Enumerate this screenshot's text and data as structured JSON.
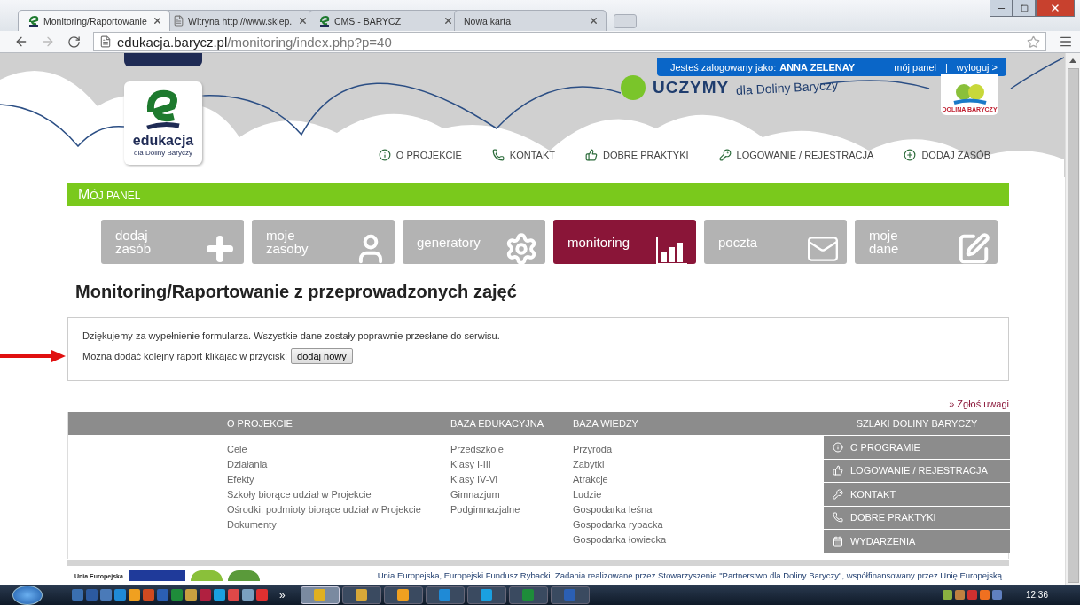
{
  "browser": {
    "tabs": [
      {
        "title": "Monitoring/Raportowanie",
        "kind": "logo",
        "selected": true
      },
      {
        "title": "Witryna http://www.sklep.",
        "kind": "document",
        "selected": false
      },
      {
        "title": "CMS - BARYCZ",
        "kind": "logo",
        "selected": false
      },
      {
        "title": "Nowa karta",
        "kind": "none",
        "selected": false
      }
    ],
    "address": {
      "domain": "edukacja.barycz.pl",
      "path": "/monitoring/index.php?p=40"
    }
  },
  "header": {
    "user_bar": {
      "prefix": "Jesteś zalogowany jako:",
      "user": "ANNA ZELENAY",
      "links": [
        "mój panel",
        "wyloguj >"
      ],
      "separator": "|"
    },
    "logo": {
      "title": "edukacja",
      "subtitle": "dla Doliny Baryczy"
    },
    "slogan": {
      "strong": "UCZYMY",
      "rest": "dla Doliny Baryczy"
    },
    "partner_logo": {
      "text": "DOLINA BARYCZY"
    },
    "nav": [
      {
        "label": "O PROJEKCIE",
        "kind": "info"
      },
      {
        "label": "KONTAKT",
        "kind": "phone"
      },
      {
        "label": "DOBRE PRAKTYKI",
        "kind": "thumb"
      },
      {
        "label": "LOGOWANIE / REJESTRACJA",
        "kind": "key"
      },
      {
        "label": "DODAJ ZASÓB",
        "kind": "plus"
      }
    ]
  },
  "panel_title": "MÓJ PANEL",
  "tiles": [
    {
      "label": "dodaj\nzasób",
      "kind": "plus",
      "selected": false
    },
    {
      "label": "moje\nzasoby",
      "kind": "user",
      "selected": false
    },
    {
      "label": "generatory",
      "kind": "gear",
      "selected": false
    },
    {
      "label": "monitoring",
      "kind": "chart",
      "selected": true
    },
    {
      "label": "poczta",
      "kind": "mail",
      "selected": false
    },
    {
      "label": "moje\ndane",
      "kind": "edit",
      "selected": false
    }
  ],
  "page_title": "Monitoring/Raportowanie z przeprowadzonych zajęć",
  "message": {
    "text": "Dziękujemy za wypełnienie formularza. Wszystkie dane zostały poprawnie przesłane do serwisu.",
    "prompt": "Można dodać kolejny raport klikając w przycisk:",
    "button": "dodaj nowy"
  },
  "report_link": "» Zgłoś uwagi",
  "footer": {
    "columns": [
      {
        "heading": "O PROJEKCIE",
        "items": [
          "Cele",
          "Działania",
          "Efekty",
          "Szkoły biorące udział w Projekcie",
          "Ośrodki, podmioty biorące udział w Projekcie",
          "Dokumenty"
        ]
      },
      {
        "heading": "BAZA EDUKACYJNA",
        "items": [
          "Przedszkole",
          "Klasy I-III",
          "Klasy IV-Vi",
          "Gimnazjum",
          "Podgimnazjalne"
        ]
      },
      {
        "heading": "BAZA WIEDZY",
        "items": [
          "Przyroda",
          "Zabytki",
          "Atrakcje",
          "Ludzie",
          "Gospodarka leśna",
          "Gospodarka rybacka",
          "Gospodarka łowiecka"
        ]
      }
    ],
    "side": {
      "heading": "SZLAKI DOLINY BARYCZY",
      "items": [
        {
          "label": "O PROGRAMIE",
          "kind": "info"
        },
        {
          "label": "LOGOWANIE / REJESTRACJA",
          "kind": "thumb"
        },
        {
          "label": "KONTAKT",
          "kind": "key"
        },
        {
          "label": "DOBRE PRAKTYKI",
          "kind": "phone"
        },
        {
          "label": "WYDARZENIA",
          "kind": "calendar"
        }
      ]
    },
    "eu_label": "Unia Europejska",
    "note": "Unia Europejska, Europejski Fundusz Rybacki. Zadania realizowane przez Stowarzyszenie \"Partnerstwo dla Doliny Baryczy\", współfinansowany przez Unię Europejską"
  },
  "taskbar": {
    "pinned": [
      {
        "color": "#3a6fb0"
      },
      {
        "color": "#2c5aa0"
      },
      {
        "color": "#4a7ab8"
      },
      {
        "color": "#1f8ad6"
      },
      {
        "color": "#f0a020"
      },
      {
        "color": "#d04a20"
      },
      {
        "color": "#2b5fb3"
      },
      {
        "color": "#1e8c3a"
      },
      {
        "color": "#c8a040"
      },
      {
        "color": "#b02040"
      },
      {
        "color": "#1aa0e0"
      },
      {
        "color": "#e04848"
      },
      {
        "color": "#7aa0c0"
      },
      {
        "color": "#e03030"
      }
    ],
    "overflow": "»",
    "windows": [
      {
        "color": "#e0b020",
        "selected": true
      },
      {
        "color": "#d8a838",
        "selected": false
      },
      {
        "color": "#f0a020",
        "selected": false
      },
      {
        "color": "#1f8ad6",
        "selected": false
      },
      {
        "color": "#1aa0e0",
        "selected": false
      },
      {
        "color": "#1e8c3a",
        "selected": false
      },
      {
        "color": "#2b5fb3",
        "selected": false
      }
    ],
    "tray": [
      {
        "color": "#8ab040"
      },
      {
        "color": "#c08040"
      },
      {
        "color": "#d03030"
      },
      {
        "color": "#f07020"
      },
      {
        "color": "#6080c0"
      }
    ],
    "time": "12:36"
  }
}
